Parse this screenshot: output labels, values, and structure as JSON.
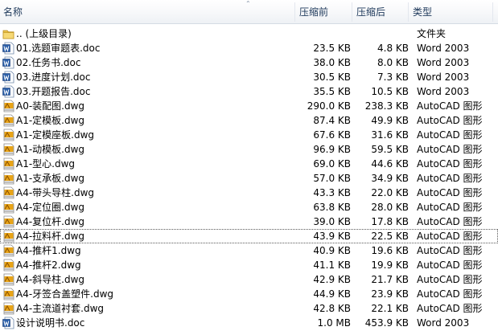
{
  "columns": {
    "name": "名称",
    "compressed": "压缩前",
    "original": "压缩后",
    "type": "类型"
  },
  "rows": [
    {
      "icon": "folder-up-icon",
      "name": ".. (上级目录)",
      "compressed": "",
      "original": "",
      "type": "文件夹"
    },
    {
      "icon": "word-doc-icon",
      "name": "01.选题审题表.doc",
      "compressed": "23.5 KB",
      "original": "4.8 KB",
      "type": "Word 2003"
    },
    {
      "icon": "word-doc-icon",
      "name": "02.任务书.doc",
      "compressed": "38.0 KB",
      "original": "8.0 KB",
      "type": "Word 2003"
    },
    {
      "icon": "word-doc-icon",
      "name": "03.进度计划.doc",
      "compressed": "30.5 KB",
      "original": "7.3 KB",
      "type": "Word 2003"
    },
    {
      "icon": "word-doc-icon",
      "name": "03.开题报告.doc",
      "compressed": "35.5 KB",
      "original": "10.5 KB",
      "type": "Word 2003"
    },
    {
      "icon": "autocad-dwg-icon",
      "name": "A0-装配图.dwg",
      "compressed": "290.0 KB",
      "original": "238.3 KB",
      "type": "AutoCAD 图形"
    },
    {
      "icon": "autocad-dwg-icon",
      "name": "A1-定模板.dwg",
      "compressed": "87.4 KB",
      "original": "49.9 KB",
      "type": "AutoCAD 图形"
    },
    {
      "icon": "autocad-dwg-icon",
      "name": "A1-定模座板.dwg",
      "compressed": "67.6 KB",
      "original": "31.6 KB",
      "type": "AutoCAD 图形"
    },
    {
      "icon": "autocad-dwg-icon",
      "name": "A1-动模板.dwg",
      "compressed": "96.9 KB",
      "original": "59.5 KB",
      "type": "AutoCAD 图形"
    },
    {
      "icon": "autocad-dwg-icon",
      "name": "A1-型心.dwg",
      "compressed": "69.0 KB",
      "original": "44.6 KB",
      "type": "AutoCAD 图形"
    },
    {
      "icon": "autocad-dwg-icon",
      "name": "A1-支承板.dwg",
      "compressed": "57.0 KB",
      "original": "34.9 KB",
      "type": "AutoCAD 图形"
    },
    {
      "icon": "autocad-dwg-icon",
      "name": "A4-带头导柱.dwg",
      "compressed": "43.3 KB",
      "original": "22.0 KB",
      "type": "AutoCAD 图形"
    },
    {
      "icon": "autocad-dwg-icon",
      "name": "A4-定位圈.dwg",
      "compressed": "63.8 KB",
      "original": "28.0 KB",
      "type": "AutoCAD 图形"
    },
    {
      "icon": "autocad-dwg-icon",
      "name": "A4-复位杆.dwg",
      "compressed": "39.0 KB",
      "original": "17.8 KB",
      "type": "AutoCAD 图形"
    },
    {
      "icon": "autocad-dwg-icon",
      "name": "A4-拉料杆.dwg",
      "compressed": "43.9 KB",
      "original": "22.5 KB",
      "type": "AutoCAD 图形",
      "focused": true
    },
    {
      "icon": "autocad-dwg-icon",
      "name": "A4-推杆1.dwg",
      "compressed": "40.9 KB",
      "original": "19.6 KB",
      "type": "AutoCAD 图形"
    },
    {
      "icon": "autocad-dwg-icon",
      "name": "A4-推杆2.dwg",
      "compressed": "41.1 KB",
      "original": "19.9 KB",
      "type": "AutoCAD 图形"
    },
    {
      "icon": "autocad-dwg-icon",
      "name": "A4-斜导柱.dwg",
      "compressed": "42.9 KB",
      "original": "21.7 KB",
      "type": "AutoCAD 图形"
    },
    {
      "icon": "autocad-dwg-icon",
      "name": "A4-牙签合盖塑件.dwg",
      "compressed": "44.9 KB",
      "original": "23.9 KB",
      "type": "AutoCAD 图形"
    },
    {
      "icon": "autocad-dwg-icon",
      "name": "A4-主流道衬套.dwg",
      "compressed": "42.8 KB",
      "original": "22.1 KB",
      "type": "AutoCAD 图形"
    },
    {
      "icon": "word-doc-icon",
      "name": "设计说明书.doc",
      "compressed": "1.0 MB",
      "original": "453.9 KB",
      "type": "Word 2003"
    }
  ]
}
